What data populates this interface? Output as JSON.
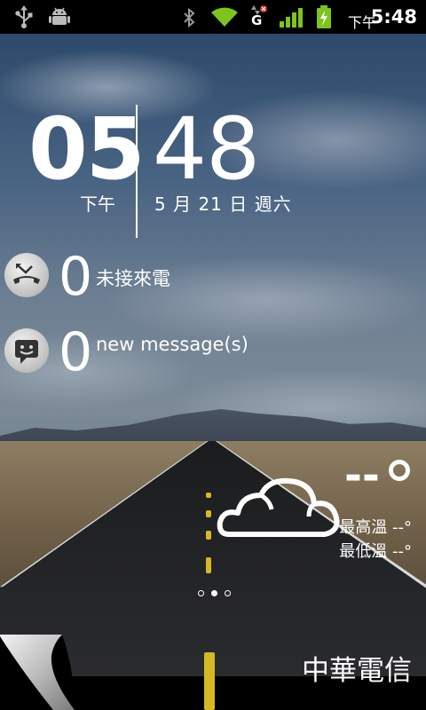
{
  "status_bar": {
    "icons_left": [
      "usb-icon",
      "android-debug-icon"
    ],
    "icons_right": [
      "bluetooth-icon",
      "wifi-icon",
      "gprs-data-icon",
      "signal-icon",
      "battery-charging-icon"
    ],
    "network_type": "G",
    "time_label": "下午",
    "time": "5:48"
  },
  "clock": {
    "hour": "05",
    "ampm": "下午",
    "minute": "48",
    "date": "5 月 21 日 週六"
  },
  "notifications": [
    {
      "icon": "missed-call-icon",
      "count": "0",
      "label": "未接來電"
    },
    {
      "icon": "message-icon",
      "count": "0",
      "label": "new message(s)"
    }
  ],
  "weather": {
    "icon": "cloud-icon",
    "temp": "--",
    "high": "最高溫 --°",
    "low": "最低溫 --°"
  },
  "pager": {
    "pages": 3,
    "active": 2
  },
  "carrier": "中華電信",
  "colors": {
    "lane": "#d6b825",
    "wifi": "#7dc41c",
    "signal": "#7dc41c",
    "battery": "#7dc41c"
  }
}
